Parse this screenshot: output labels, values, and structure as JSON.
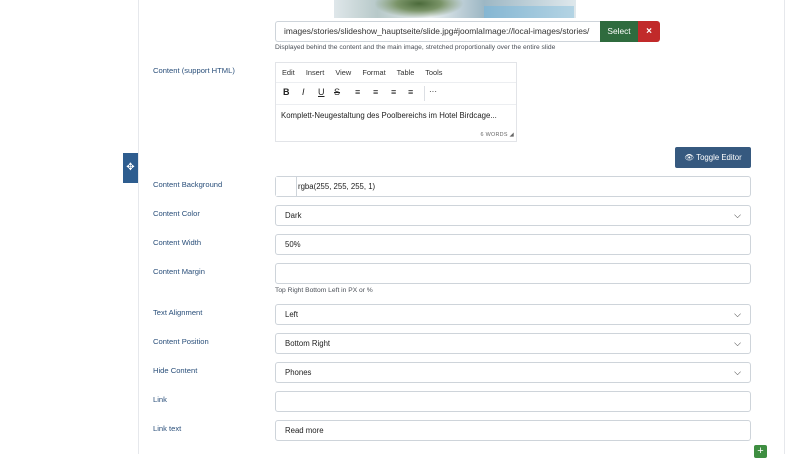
{
  "image_field": {
    "path_value": "images/stories/slideshow_hauptseite/slide.jpg#joomlaImage://local-images/stories/",
    "select_label": "Select",
    "clear_label": "×",
    "helper_text": "Displayed behind the content and the main image, stretched proportionally over the entire slide"
  },
  "content_field": {
    "label": "Content (support HTML)",
    "menu": [
      "Edit",
      "Insert",
      "View",
      "Format",
      "Table",
      "Tools"
    ],
    "toolbar_icons": [
      "bold-icon",
      "italic-icon",
      "underline-icon",
      "strikethrough-icon",
      "align-left-icon",
      "align-center-icon",
      "align-right-icon",
      "align-justify-icon",
      "more-icon"
    ],
    "toolbar_glyphs": [
      "B",
      "I",
      "U",
      "S",
      "≡",
      "≡",
      "≡",
      "≡",
      "···"
    ],
    "body_text": "Komplett-Neugestaltung des Poolbereichs  im Hotel Birdcage...",
    "word_count": "6 WORDS",
    "toggle_editor_label": "Toggle Editor"
  },
  "fields": {
    "content_background": {
      "label": "Content Background",
      "value": "rgba(255, 255, 255, 1)"
    },
    "content_color": {
      "label": "Content Color",
      "value": "Dark"
    },
    "content_width": {
      "label": "Content Width",
      "value": "50%"
    },
    "content_margin": {
      "label": "Content Margin",
      "value": "",
      "helper": "Top Right Bottom Left in PX or %"
    },
    "text_alignment": {
      "label": "Text Alignment",
      "value": "Left"
    },
    "content_position": {
      "label": "Content Position",
      "value": "Bottom Right"
    },
    "hide_content": {
      "label": "Hide Content",
      "value": "Phones"
    },
    "link": {
      "label": "Link",
      "value": ""
    },
    "link_text": {
      "label": "Link text",
      "value": "Read more"
    }
  },
  "colors": {
    "label_blue": "#2a4f7a",
    "select_green": "#2f6b3e",
    "clear_red": "#c12a2a",
    "toggle_blue": "#36597f",
    "add_green": "#3e8e41"
  }
}
